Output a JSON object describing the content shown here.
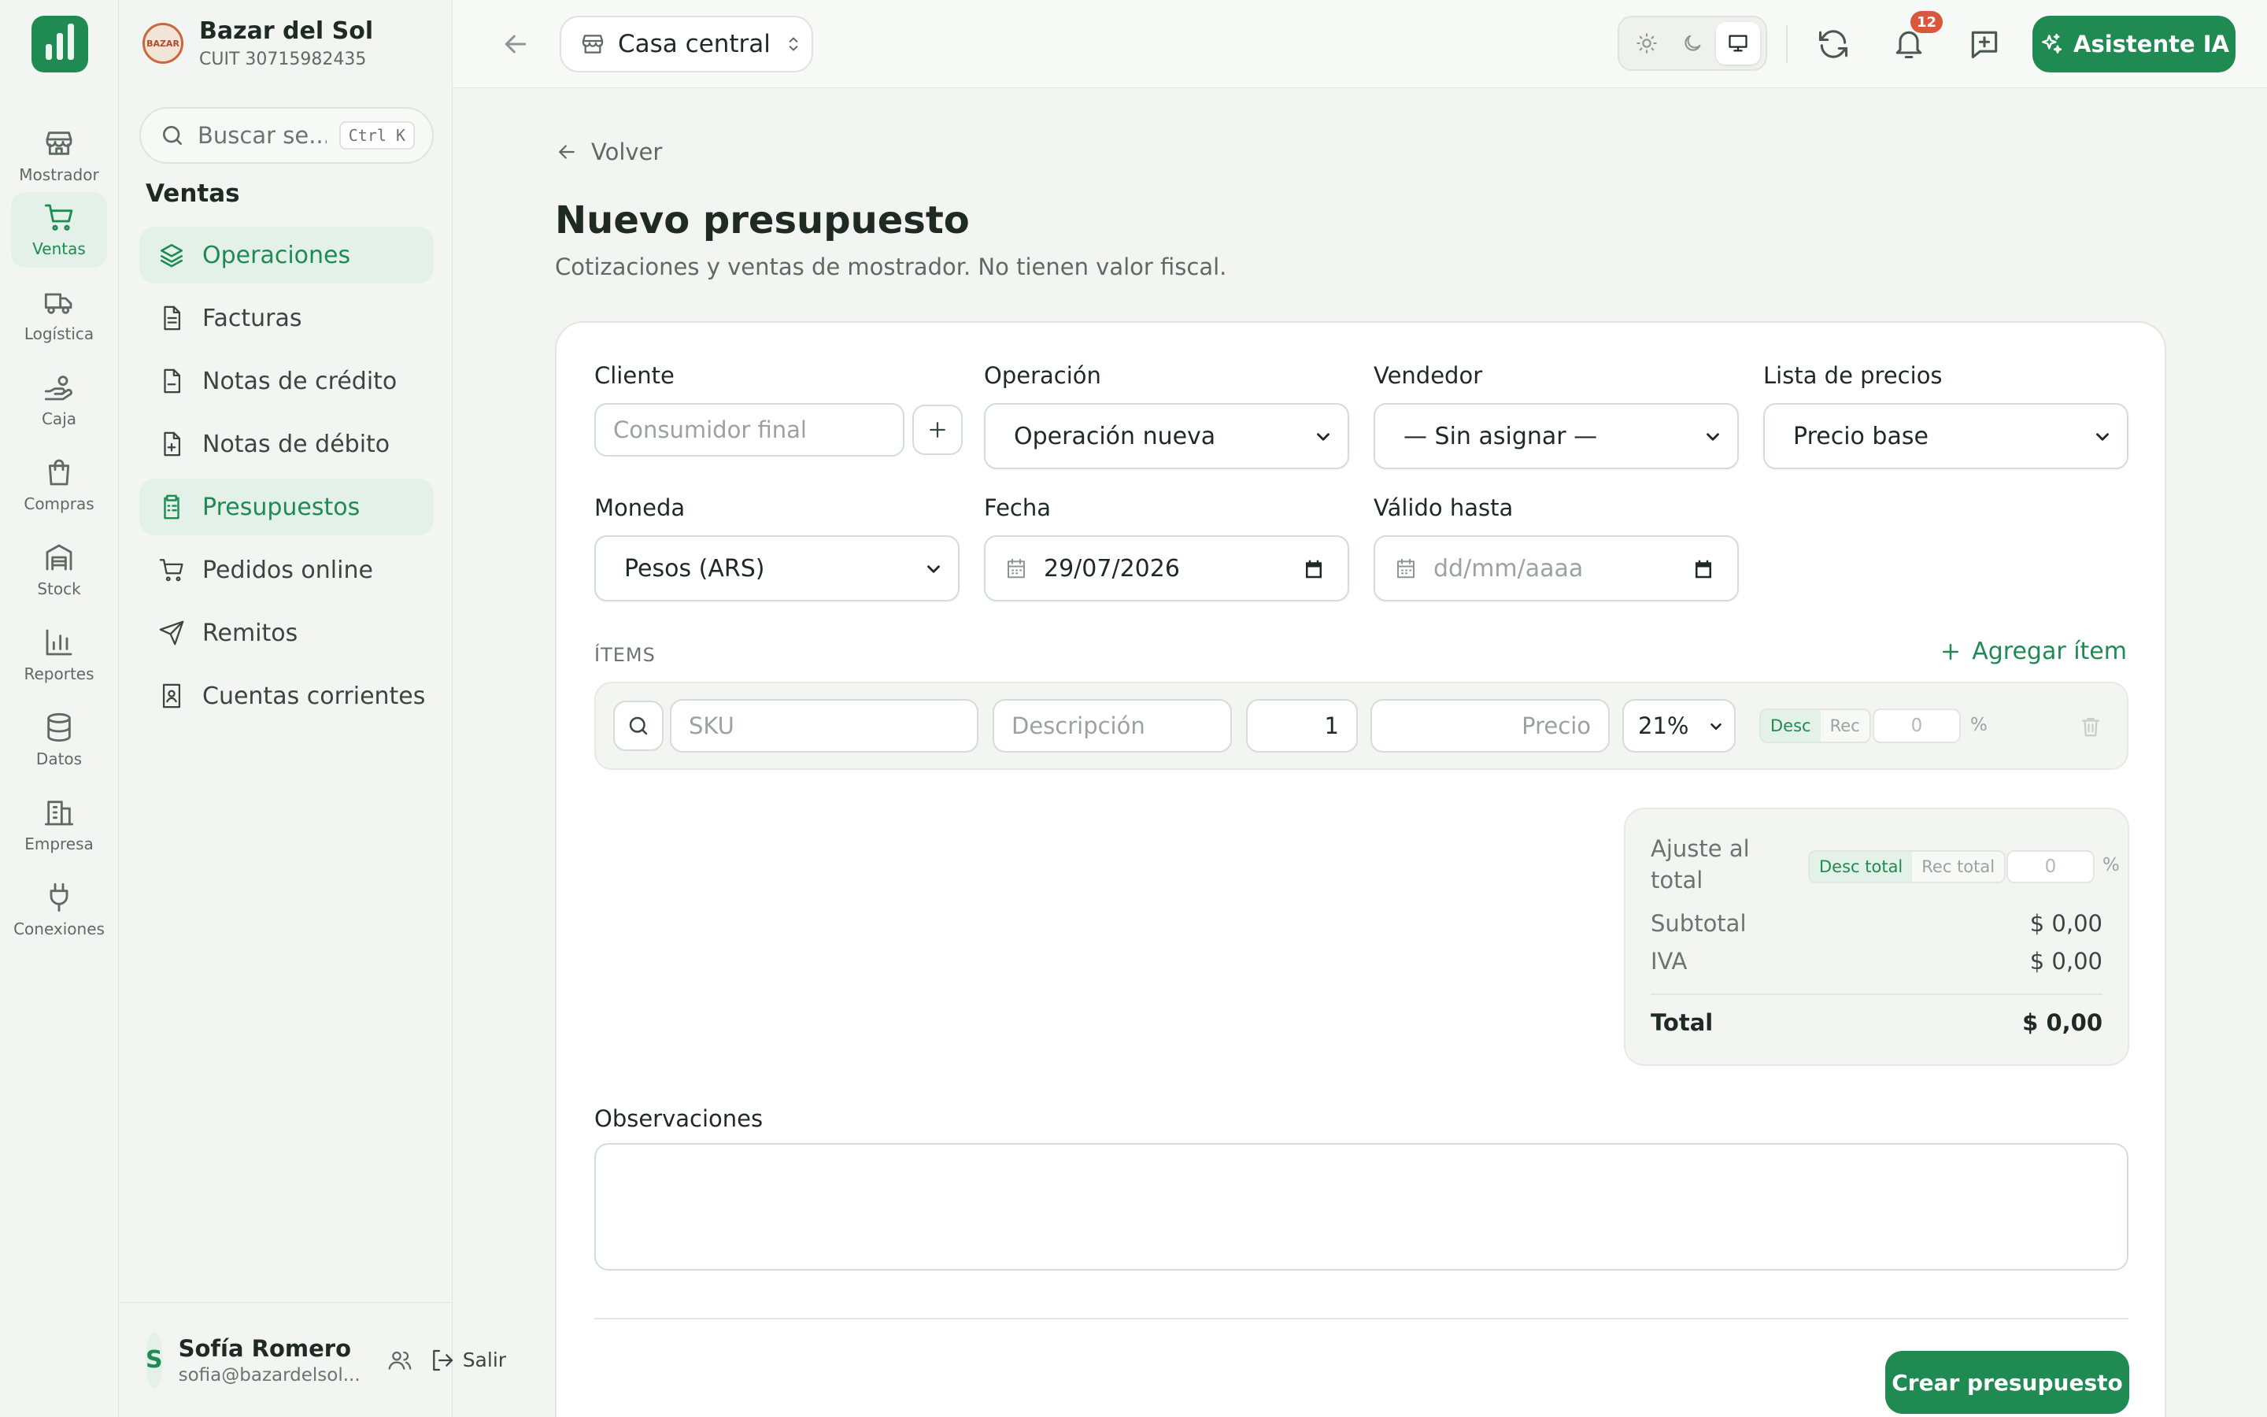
{
  "rail": {
    "items": [
      {
        "label": "Mostrador",
        "icon": "store-icon"
      },
      {
        "label": "Ventas",
        "icon": "cart-icon",
        "active": true
      },
      {
        "label": "Logística",
        "icon": "truck-icon"
      },
      {
        "label": "Caja",
        "icon": "hand-coins-icon"
      },
      {
        "label": "Compras",
        "icon": "shopping-bag-icon"
      },
      {
        "label": "Stock",
        "icon": "warehouse-icon"
      },
      {
        "label": "Reportes",
        "icon": "bar-chart-icon"
      },
      {
        "label": "Datos",
        "icon": "database-icon"
      },
      {
        "label": "Empresa",
        "icon": "building-icon"
      },
      {
        "label": "Conexiones",
        "icon": "plug-icon"
      }
    ]
  },
  "sidebar": {
    "company_name": "Bazar del Sol",
    "company_cuit": "CUIT 30715982435",
    "logo_text": "BAZAR",
    "search_placeholder": "Buscar se...",
    "search_shortcut": "Ctrl K",
    "section_title": "Ventas",
    "items": [
      {
        "label": "Operaciones",
        "icon": "layers-icon",
        "active": true
      },
      {
        "label": "Facturas",
        "icon": "file-text-icon"
      },
      {
        "label": "Notas de crédito",
        "icon": "file-minus-icon"
      },
      {
        "label": "Notas de débito",
        "icon": "file-plus-icon"
      },
      {
        "label": "Presupuestos",
        "icon": "clipboard-list-icon",
        "active": true
      },
      {
        "label": "Pedidos online",
        "icon": "cart-icon"
      },
      {
        "label": "Remitos",
        "icon": "send-icon"
      },
      {
        "label": "Cuentas corrientes",
        "icon": "contact-book-icon"
      }
    ],
    "user": {
      "initial": "S",
      "name": "Sofía Romero",
      "email": "sofia@bazardelsol...",
      "logout_label": "Salir"
    }
  },
  "topbar": {
    "branch": "Casa central",
    "notifications_count": "12",
    "ai_button": "Asistente IA",
    "theme_selected": "system"
  },
  "page": {
    "back_label": "Volver",
    "title": "Nuevo presupuesto",
    "subtitle": "Cotizaciones y ventas de mostrador. No tienen valor fiscal."
  },
  "form": {
    "cliente_label": "Cliente",
    "cliente_placeholder": "Consumidor final",
    "operacion_label": "Operación",
    "operacion_value": "Operación nueva",
    "vendedor_label": "Vendedor",
    "vendedor_value": "— Sin asignar —",
    "lista_label": "Lista de precios",
    "lista_value": "Precio base",
    "moneda_label": "Moneda",
    "moneda_value": "Pesos (ARS)",
    "fecha_label": "Fecha",
    "fecha_value": "29/07/2026",
    "valido_label": "Válido hasta",
    "valido_placeholder": "dd/mm/aaaa"
  },
  "items": {
    "section_label": "ÍTEMS",
    "add_label": "Agregar ítem",
    "row": {
      "sku_placeholder": "SKU",
      "desc_placeholder": "Descripción",
      "qty_value": "1",
      "price_placeholder": "Precio",
      "iva_value": "21%",
      "desc_toggle": "Desc",
      "rec_toggle": "Rec",
      "pct_value": "0",
      "pct_symbol": "%"
    }
  },
  "totals": {
    "adjust_label": "Ajuste al total",
    "desc_total": "Desc total",
    "rec_total": "Rec total",
    "adjust_value": "0",
    "pct_symbol": "%",
    "subtotal_label": "Subtotal",
    "subtotal_value": "$ 0,00",
    "iva_label": "IVA",
    "iva_value": "$ 0,00",
    "total_label": "Total",
    "total_value": "$ 0,00"
  },
  "observaciones": {
    "label": "Observaciones",
    "value": ""
  },
  "actions": {
    "create_label": "Crear presupuesto"
  },
  "colors": {
    "accent": "#1f8a52",
    "accent_soft": "#e3f1e8",
    "badge": "#d9583b",
    "background": "#f3f5f3"
  }
}
